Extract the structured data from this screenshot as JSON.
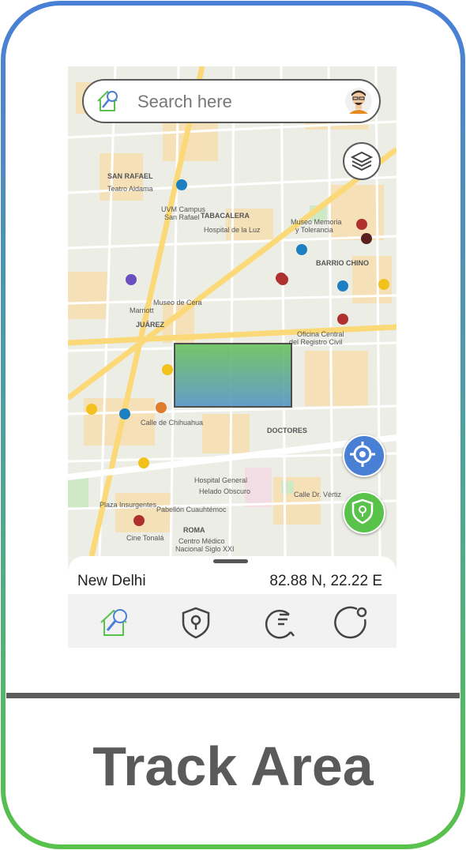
{
  "search": {
    "placeholder": "Search here"
  },
  "location": {
    "name": "New Delhi",
    "coords": "82.88 N, 22.22 E"
  },
  "footer": {
    "title": "Track Area"
  },
  "map": {
    "labels": [
      "SAN RAFAEL",
      "Teatro Aldama",
      "TABACALERA",
      "UVM Campus San Rafael",
      "Hospital de la Luz",
      "Museo Memoria y Tolerancia",
      "BARRIO CHINO",
      "JUÁREZ",
      "Museo de Cera",
      "Marriott",
      "Oficina Central del Registro Civil",
      "DOCTORES",
      "Hospital General",
      "Helado Obscuro",
      "Pabellón Cuauhtémoc",
      "Plaza Insurgentes",
      "Cine Tonalá",
      "ROMA",
      "Centro Médico Nacional Siglo XXI",
      "Calle de Chihuahua",
      "Calle Dr. Vértiz"
    ]
  },
  "nav": [
    "home-search",
    "safe-zone",
    "history",
    "profile"
  ],
  "colors": {
    "border_top": "#4a7fd6",
    "border_bottom": "#58c24a",
    "locate": "#4a7fd6",
    "shield": "#58c24a"
  }
}
